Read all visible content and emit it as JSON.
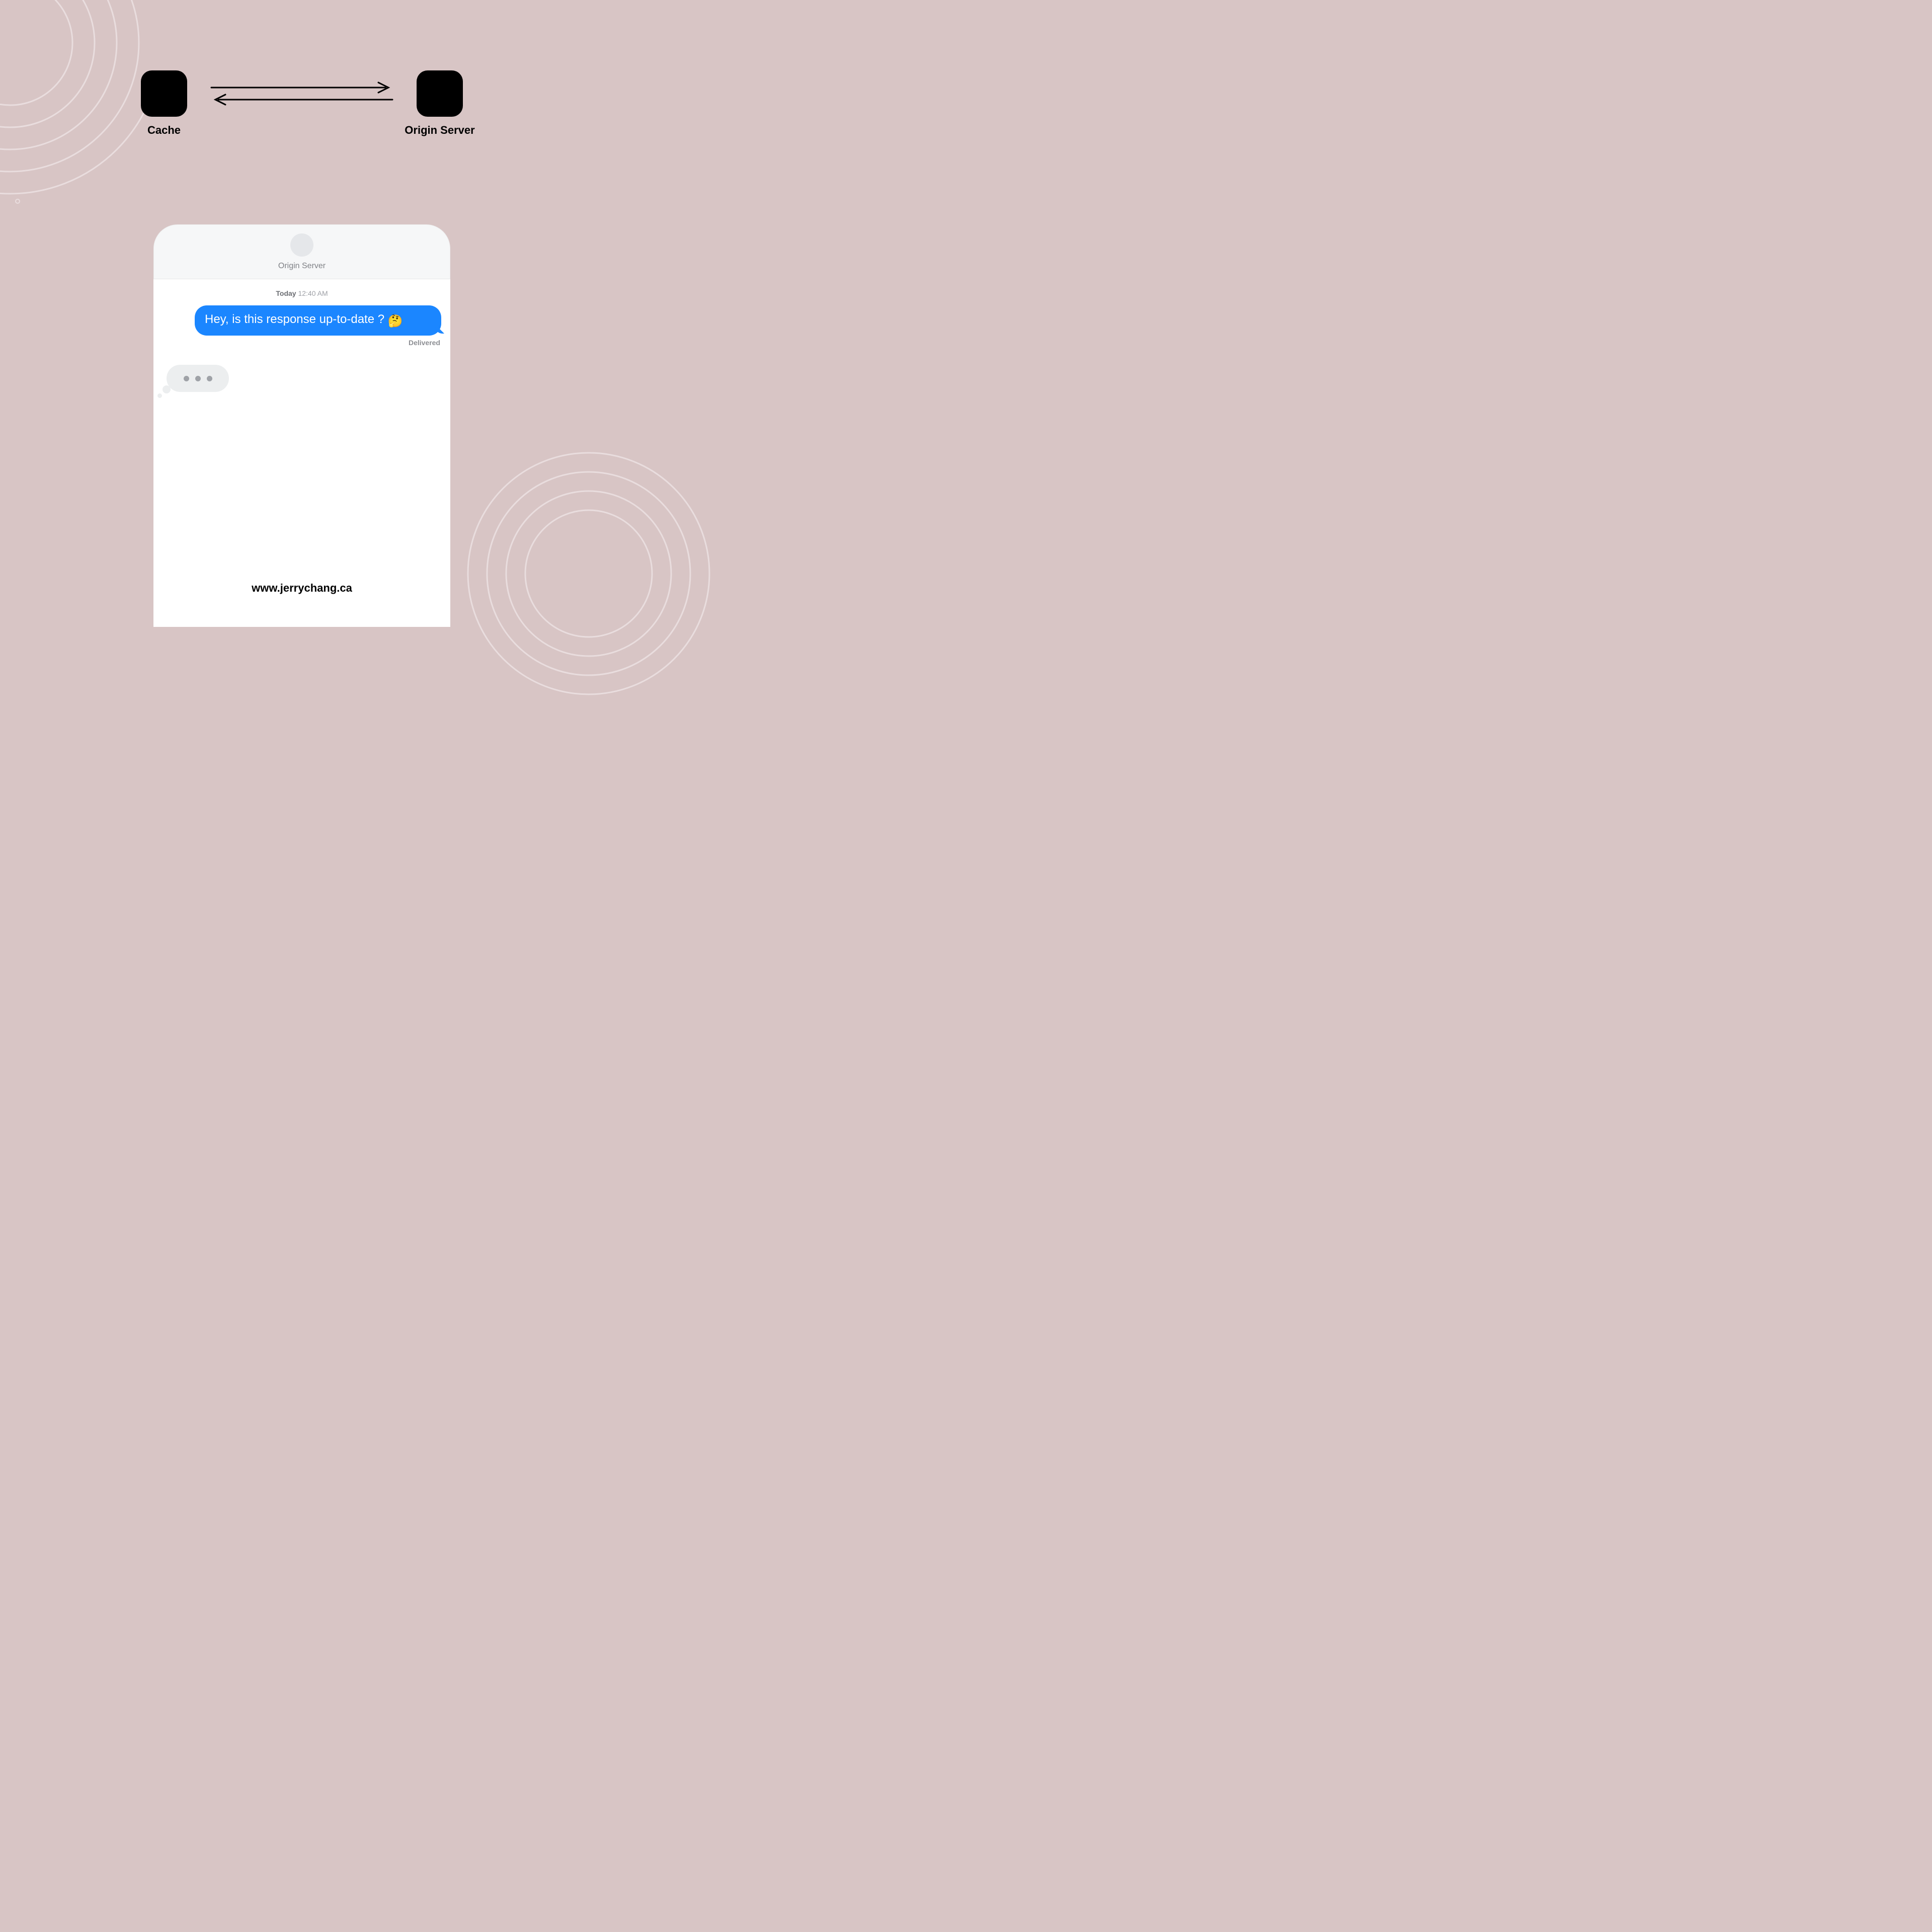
{
  "diagram": {
    "left_node_label": "Cache",
    "right_node_label": "Origin Server"
  },
  "chat": {
    "contact_name": "Origin Server",
    "timestamp_day": "Today",
    "timestamp_time": "12:40 AM",
    "outgoing_message": "Hey, is this response up-to-date ?",
    "outgoing_emoji": "🤔",
    "delivery_status": "Delivered"
  },
  "footer": {
    "url": "www.jerrychang.ca"
  }
}
